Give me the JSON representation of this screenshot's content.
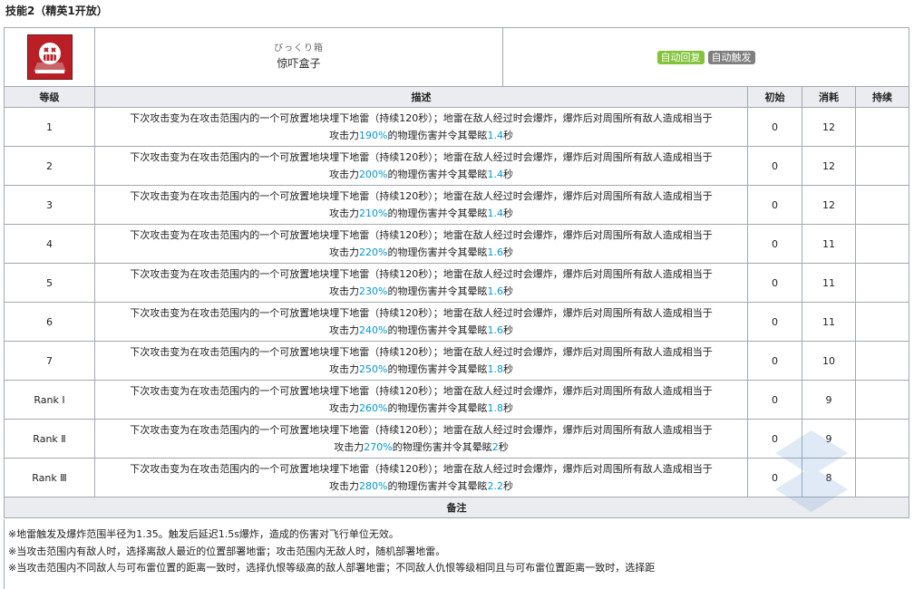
{
  "title": "技能2（精英1开放）",
  "skill": {
    "jp_name": "びっくり箱",
    "cn_name": "惊吓盒子",
    "tags": [
      {
        "label": "自动回复",
        "color": "#83c33a"
      },
      {
        "label": "自动触发",
        "color": "#7f7f7f"
      }
    ],
    "icon": "screaming-face-icon"
  },
  "columns": {
    "level": "等级",
    "description": "描述",
    "initial": "初始",
    "cost": "消耗",
    "duration": "持续"
  },
  "desc_text": {
    "line1": "下次攻击变为在攻击范围内的一个可放置地块埋下地雷（持续120秒）；地雷在敌人经过时会爆炸，爆炸后对周围所有敌人造成相当于",
    "prefix": "攻击力",
    "middle": "的物理伤害并令其晕眩",
    "suffix": "秒"
  },
  "rows": [
    {
      "level": "1",
      "atk": "190%",
      "stun": "1.4",
      "initial": "0",
      "cost": "12",
      "duration": ""
    },
    {
      "level": "2",
      "atk": "200%",
      "stun": "1.4",
      "initial": "0",
      "cost": "12",
      "duration": ""
    },
    {
      "level": "3",
      "atk": "210%",
      "stun": "1.4",
      "initial": "0",
      "cost": "12",
      "duration": ""
    },
    {
      "level": "4",
      "atk": "220%",
      "stun": "1.6",
      "initial": "0",
      "cost": "11",
      "duration": ""
    },
    {
      "level": "5",
      "atk": "230%",
      "stun": "1.6",
      "initial": "0",
      "cost": "11",
      "duration": ""
    },
    {
      "level": "6",
      "atk": "240%",
      "stun": "1.6",
      "initial": "0",
      "cost": "11",
      "duration": ""
    },
    {
      "level": "7",
      "atk": "250%",
      "stun": "1.8",
      "initial": "0",
      "cost": "10",
      "duration": ""
    },
    {
      "level": "Rank Ⅰ",
      "atk": "260%",
      "stun": "1.8",
      "initial": "0",
      "cost": "9",
      "duration": ""
    },
    {
      "level": "Rank Ⅱ",
      "atk": "270%",
      "stun": "2",
      "initial": "0",
      "cost": "9",
      "duration": ""
    },
    {
      "level": "Rank Ⅲ",
      "atk": "280%",
      "stun": "2.2",
      "initial": "0",
      "cost": "8",
      "duration": ""
    }
  ],
  "notes_header": "备注",
  "notes": [
    "※地雷触发及爆炸范围半径为1.35。触发后延迟1.5s爆炸，造成的伤害对飞行单位无效。",
    "※当攻击范围内有敌人时，选择离敌人最近的位置部署地雷；攻击范围内无敌人时，随机部署地雷。",
    "※当攻击范围内不同敌人与可布雷位置的距离一致时，选择仇恨等级高的敌人部署地雷；不同敌人仇恨等级相同且与可布雷位置距离一致时，选择距"
  ]
}
